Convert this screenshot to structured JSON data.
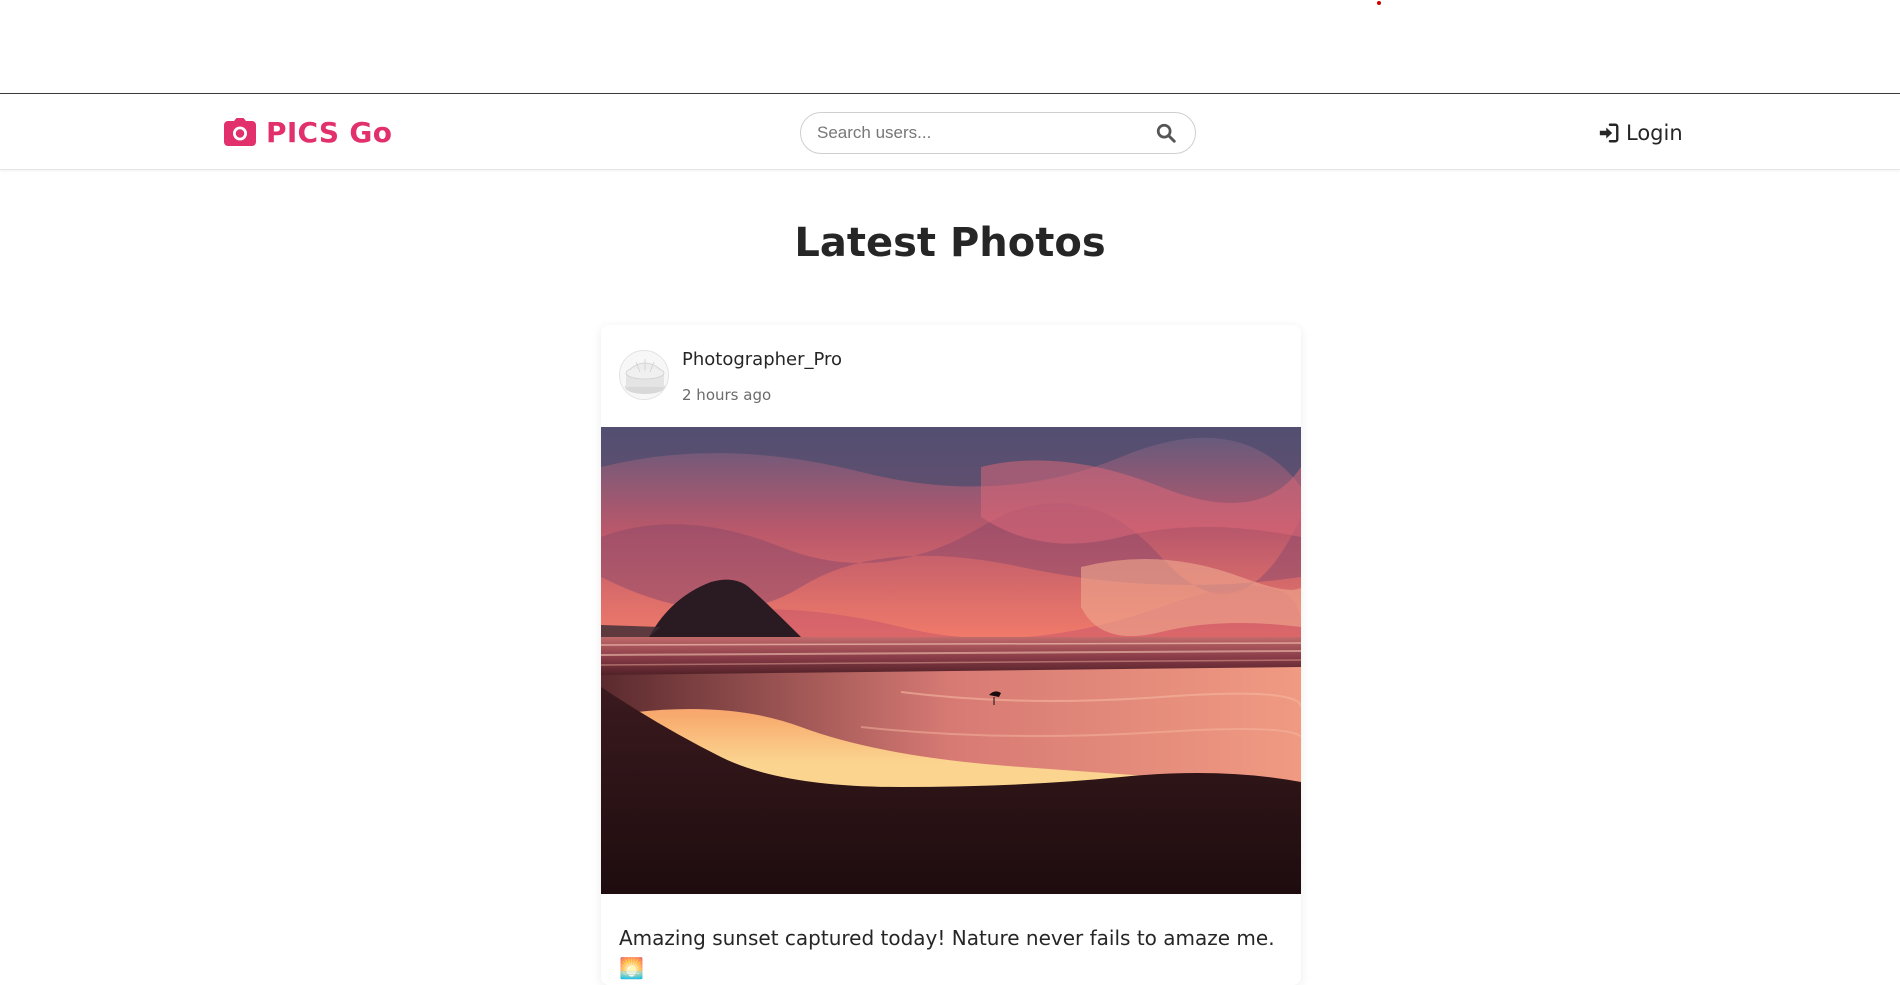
{
  "header": {
    "brand": "PICS Go",
    "search_placeholder": "Search users...",
    "login_label": "Login"
  },
  "main": {
    "title": "Latest Photos",
    "posts": [
      {
        "username": "Photographer_Pro",
        "timestamp": "2 hours ago",
        "caption": "Amazing sunset captured today! Nature never fails to amaze me. 🌅"
      }
    ]
  },
  "icons": {
    "brand": "camera-icon",
    "search": "search-icon",
    "login": "sign-in-icon"
  },
  "colors": {
    "brand": "#e1306c",
    "text": "#262626",
    "muted": "#6b6b6b"
  }
}
